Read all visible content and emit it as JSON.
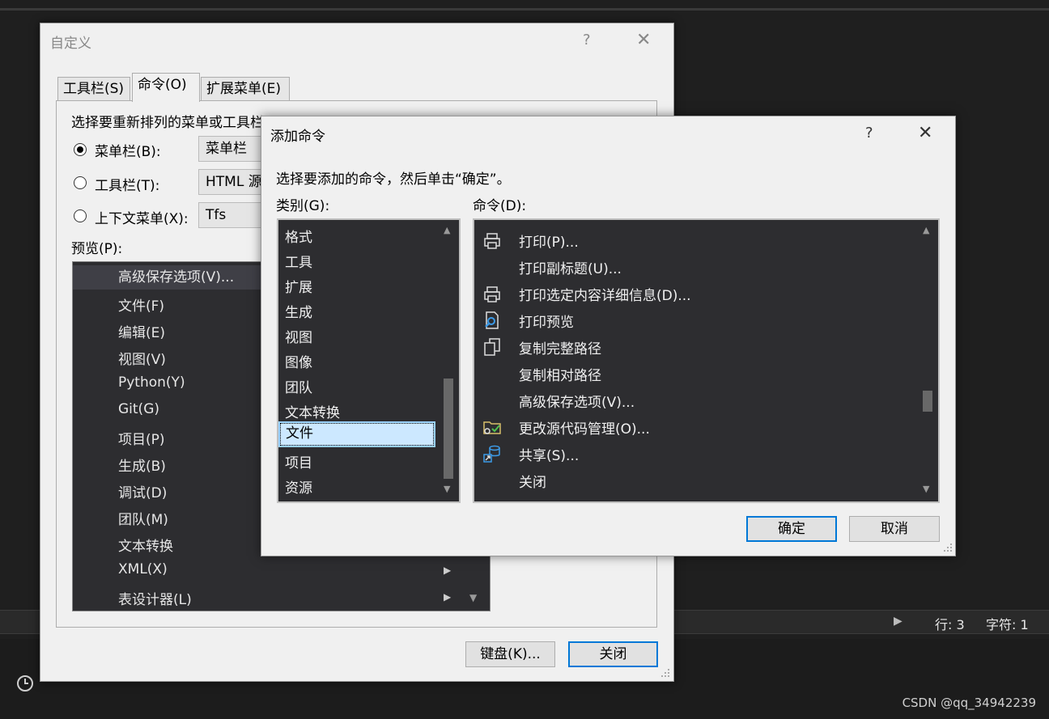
{
  "ide": {
    "status_line": "行: 3",
    "status_char": "字符: 1",
    "watermark": "CSDN @qq_34942239"
  },
  "customize": {
    "title": "自定义",
    "help": "?",
    "close": "✕",
    "tabs": [
      "工具栏(S)",
      "命令(O)",
      "扩展菜单(E)"
    ],
    "instruction": "选择要重新排列的菜单或工具栏:",
    "radio_menubar": "菜单栏(B):",
    "radio_toolbar": "工具栏(T):",
    "radio_context": "上下文菜单(X):",
    "combo_menubar": "菜单栏",
    "combo_toolbar": "HTML 源",
    "combo_context": "Tfs",
    "preview_label": "预览(P):",
    "preview_items": [
      "高级保存选项(V)...",
      "文件(F)",
      "编辑(E)",
      "视图(V)",
      "Python(Y)",
      "Git(G)",
      "项目(P)",
      "生成(B)",
      "调试(D)",
      "团队(M)",
      "文本转换",
      "XML(X)",
      "表设计器(L)"
    ],
    "keyboard_button": "键盘(K)...",
    "close_button": "关闭"
  },
  "add_command": {
    "title": "添加命令",
    "help": "?",
    "close": "✕",
    "instruction": "选择要添加的命令，然后单击“确定”。",
    "category_label": "类别(G):",
    "command_label": "命令(D):",
    "categories": [
      "格式",
      "工具",
      "扩展",
      "生成",
      "视图",
      "图像",
      "团队",
      "文本转换",
      "文件",
      "项目",
      "资源"
    ],
    "selected_category": "文件",
    "commands": [
      {
        "label": "打印(P)...",
        "icon": "printer-icon"
      },
      {
        "label": "打印副标题(U)...",
        "icon": ""
      },
      {
        "label": "打印选定内容详细信息(D)...",
        "icon": "printer-icon"
      },
      {
        "label": "打印预览",
        "icon": "print-preview-icon"
      },
      {
        "label": "复制完整路径",
        "icon": "copy-icon"
      },
      {
        "label": "复制相对路径",
        "icon": ""
      },
      {
        "label": "高级保存选项(V)...",
        "icon": ""
      },
      {
        "label": "更改源代码管理(O)...",
        "icon": "source-control-icon"
      },
      {
        "label": "共享(S)...",
        "icon": "share-database-icon"
      },
      {
        "label": "关闭",
        "icon": ""
      }
    ],
    "ok_button": "确定",
    "cancel_button": "取消"
  }
}
